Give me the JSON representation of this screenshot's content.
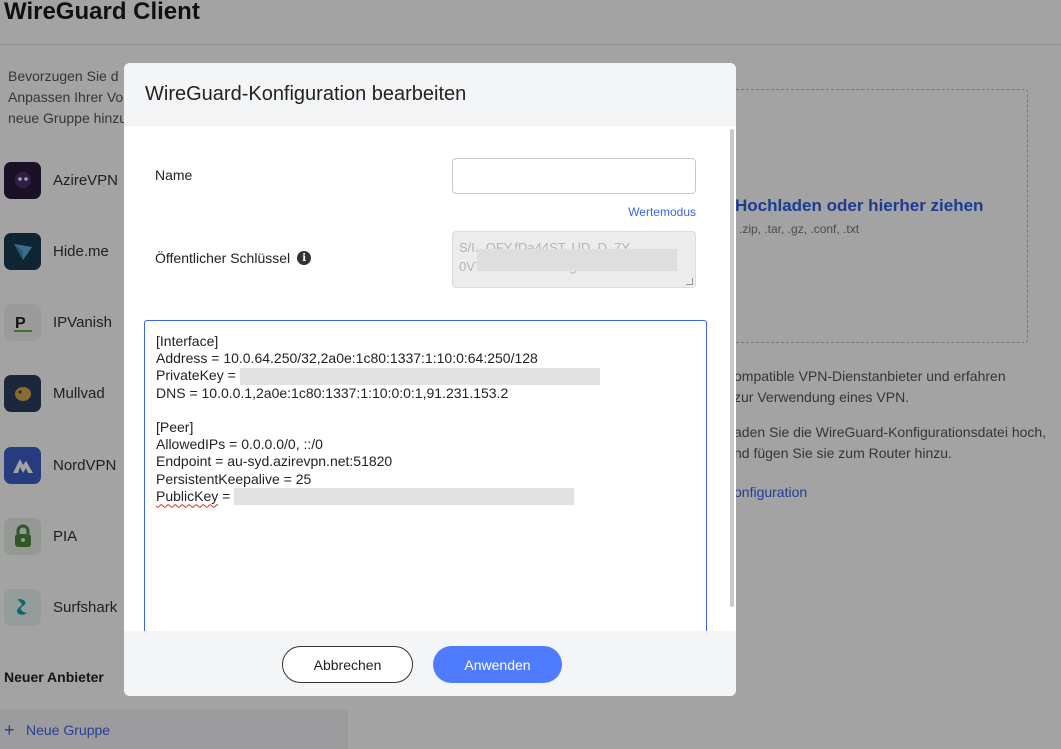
{
  "app": {
    "title": "WireGuard Client"
  },
  "sidebar": {
    "intro": "Bevorzugen Sie d\nAnpassen Ihrer Vo\nneue Gruppe hinzu",
    "providers": [
      {
        "name": "AzireVPN",
        "icon": "azirevpn-logo-icon",
        "color": "#2a1b3d"
      },
      {
        "name": "Hide.me",
        "icon": "hideme-logo-icon",
        "color": "#1a3b52"
      },
      {
        "name": "IPVanish",
        "icon": "ipvanish-logo-icon",
        "color": "#f2f2f2"
      },
      {
        "name": "Mullvad",
        "icon": "mullvad-logo-icon",
        "color": "#2b3f5e"
      },
      {
        "name": "NordVPN",
        "icon": "nordvpn-logo-icon",
        "color": "#3e5fc7"
      },
      {
        "name": "PIA",
        "icon": "pia-logo-icon",
        "color": "#e9efe7"
      },
      {
        "name": "Surfshark",
        "icon": "surfshark-logo-icon",
        "color": "#eaf6f5"
      }
    ],
    "new_provider_heading": "Neuer Anbieter",
    "new_group": {
      "icon": "plus-icon",
      "label": "Neue Gruppe"
    }
  },
  "main": {
    "upload_title": "Hochladen oder hierher ziehen",
    "upload_types": ".zip, .tar, .gz, .conf, .txt",
    "info1": "ompatible VPN-Dienstanbieter und erfahren\nzur Verwendung eines VPN.",
    "info2": "aden Sie die WireGuard-Konfigurationsdatei hoch,\nnd fügen Sie sie zum Router hinzu.",
    "link": "onfiguration"
  },
  "modal": {
    "title": "WireGuard-Konfiguration bearbeiten",
    "name_label": "Name",
    "name_value": "",
    "value_mode_link": "Wertemodus",
    "pubkey_label": "Öffentlicher Schlüssel",
    "pubkey_info_icon": "info-icon",
    "pubkey_text_line1": "S/I...OFY.fDa44ST..UD..D..7Y",
    "pubkey_text_line2": "0V7DdkrWlc0oVVIlgRE00",
    "config": {
      "interface_header": "[Interface]",
      "address": "Address = 10.0.64.250/32,2a0e:1c80:1337:1:10:0:64:250/128",
      "private_key_label": "PrivateKey =",
      "dns": "DNS = 10.0.0.1,2a0e:1c80:1337:1:10:0:0:1,91.231.153.2",
      "peer_header": "[Peer]",
      "allowed_ips": "AllowedIPs = 0.0.0.0/0, ::/0",
      "endpoint": "Endpoint = au-syd.azirevpn.net:51820",
      "keepalive": "PersistentKeepalive = 25",
      "public_key_word": "PublicKey",
      "public_key_eq": " ="
    },
    "cancel_label": "Abbrechen",
    "apply_label": "Anwenden",
    "accent_color": "#4f7cff"
  }
}
